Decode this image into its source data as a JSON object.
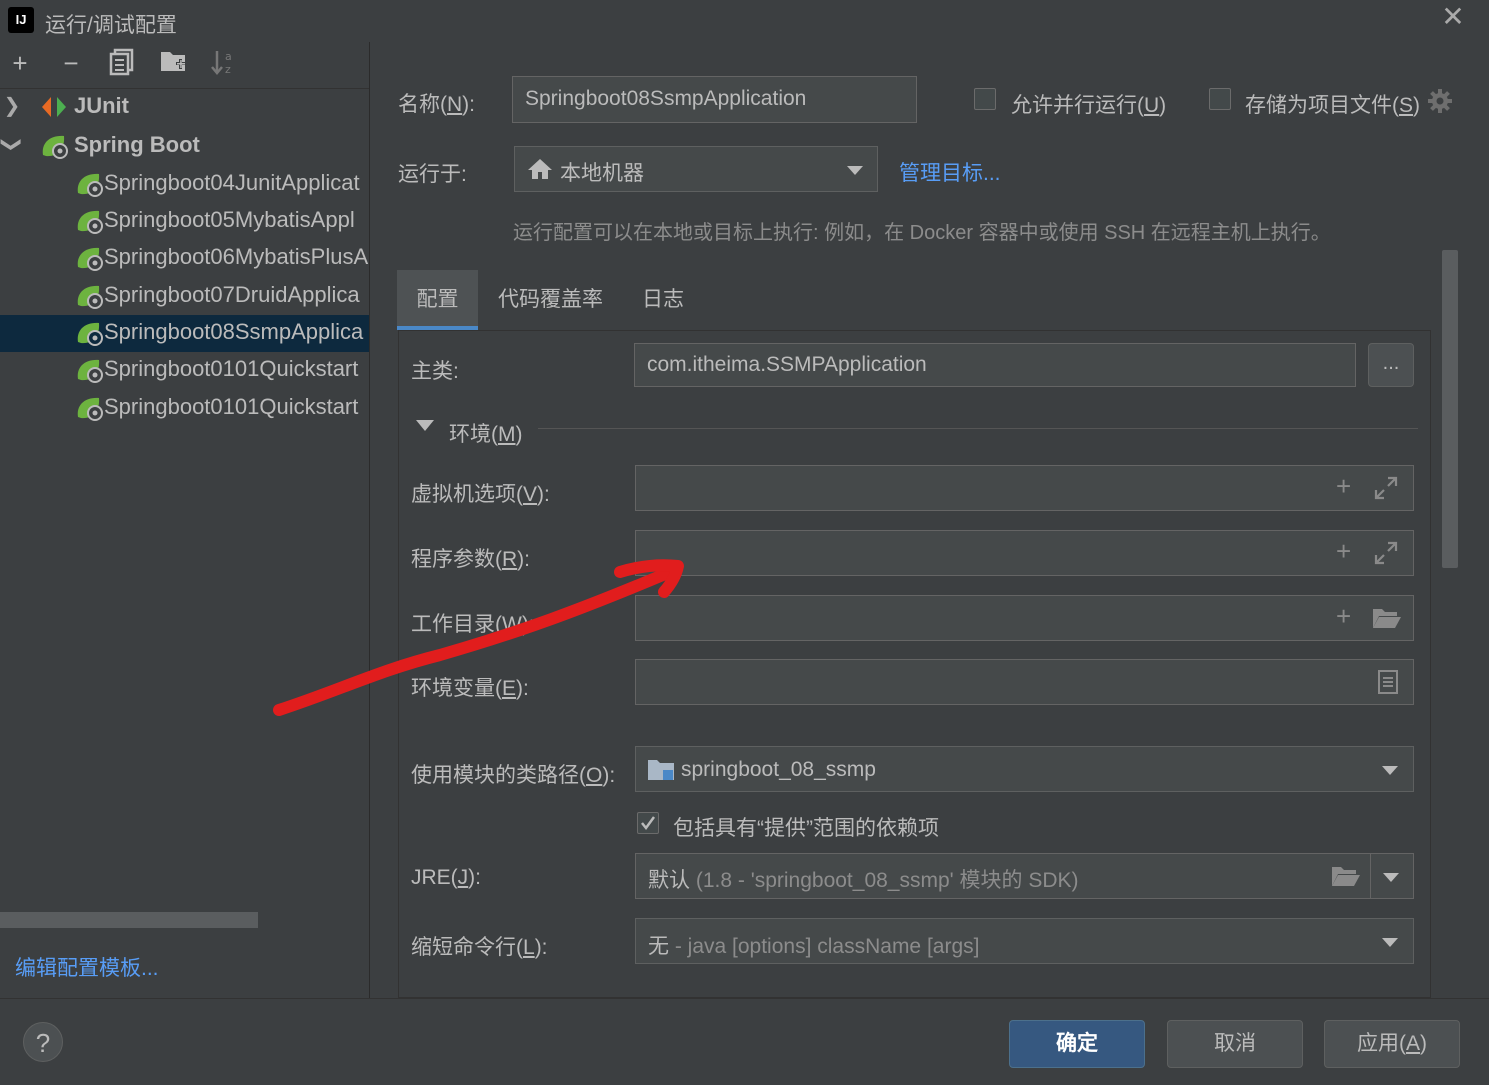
{
  "window": {
    "title": "运行/调试配置",
    "close_icon": "close-icon"
  },
  "toolbar": {
    "add": "+",
    "remove": "−",
    "copy_icon": "copy-icon",
    "folder_icon": "new-folder-icon",
    "sort_icon": "sort-alpha-icon"
  },
  "tree": {
    "groups": [
      {
        "label": "JUnit",
        "expanded": false
      },
      {
        "label": "Spring Boot",
        "expanded": true
      }
    ],
    "items": [
      {
        "label": "Springboot04JunitApplicat"
      },
      {
        "label": "Springboot05MybatisAppl"
      },
      {
        "label": "Springboot06MybatisPlusA"
      },
      {
        "label": "Springboot07DruidApplica"
      },
      {
        "label": "Springboot08SsmpApplica",
        "selected": true
      },
      {
        "label": "Springboot0101Quickstart"
      },
      {
        "label": "Springboot0101Quickstart"
      }
    ],
    "edit_templates": "编辑配置模板..."
  },
  "form": {
    "name_label_pre": "名称(",
    "name_label_key": "N",
    "name_label_post": "):",
    "name_value": "Springboot08SsmpApplication",
    "allow_parallel_pre": "允许并行运行(",
    "allow_parallel_key": "U",
    "allow_parallel_post": ")",
    "allow_parallel_checked": false,
    "store_file_pre": "存储为项目文件(",
    "store_file_key": "S",
    "store_file_post": ")",
    "store_file_checked": false,
    "run_on_label": "运行于:",
    "run_on_value": "本地机器",
    "manage_targets": "管理目标...",
    "run_on_hint": "运行配置可以在本地或目标上执行: 例如，在 Docker 容器中或使用 SSH 在远程主机上执行。"
  },
  "tabs": [
    {
      "label": "配置",
      "active": true
    },
    {
      "label": "代码覆盖率",
      "active": false
    },
    {
      "label": "日志",
      "active": false
    }
  ],
  "config": {
    "main_class_label": "主类:",
    "main_class_value": "com.itheima.SSMPApplication",
    "browse_button": "...",
    "env_section_pre": "环境(",
    "env_section_key": "M",
    "env_section_post": ")",
    "vm_options_pre": "虚拟机选项(",
    "vm_options_key": "V",
    "vm_options_post": "):",
    "vm_options_value": "",
    "program_args_pre": "程序参数(",
    "program_args_key": "R",
    "program_args_post": "):",
    "program_args_value": "",
    "working_dir_pre": "工作目录(",
    "working_dir_key": "W",
    "working_dir_post": "):",
    "working_dir_value": "",
    "env_vars_pre": "环境变量(",
    "env_vars_key": "E",
    "env_vars_post": "):",
    "env_vars_value": "",
    "module_classpath_pre": "使用模块的类路径(",
    "module_classpath_key": "O",
    "module_classpath_post": "):",
    "module_value": "springboot_08_ssmp",
    "include_provided": "包括具有“提供”范围的依赖项",
    "include_provided_checked": true,
    "jre_pre": "JRE(",
    "jre_key": "J",
    "jre_post": "):",
    "jre_default": "默认",
    "jre_detail": "(1.8 - 'springboot_08_ssmp' 模块的 SDK)",
    "shorten_pre": "缩短命令行(",
    "shorten_key": "L",
    "shorten_post": "):",
    "shorten_none": "无",
    "shorten_detail": "- java [options] className [args]"
  },
  "buttons": {
    "help": "?",
    "ok": "确定",
    "cancel": "取消",
    "apply_pre": "应用(",
    "apply_key": "A",
    "apply_post": ")"
  },
  "colors": {
    "accent": "#4a88c7",
    "link": "#589df6",
    "annotation_arrow": "#e11d1d",
    "selection": "#0d293e"
  }
}
